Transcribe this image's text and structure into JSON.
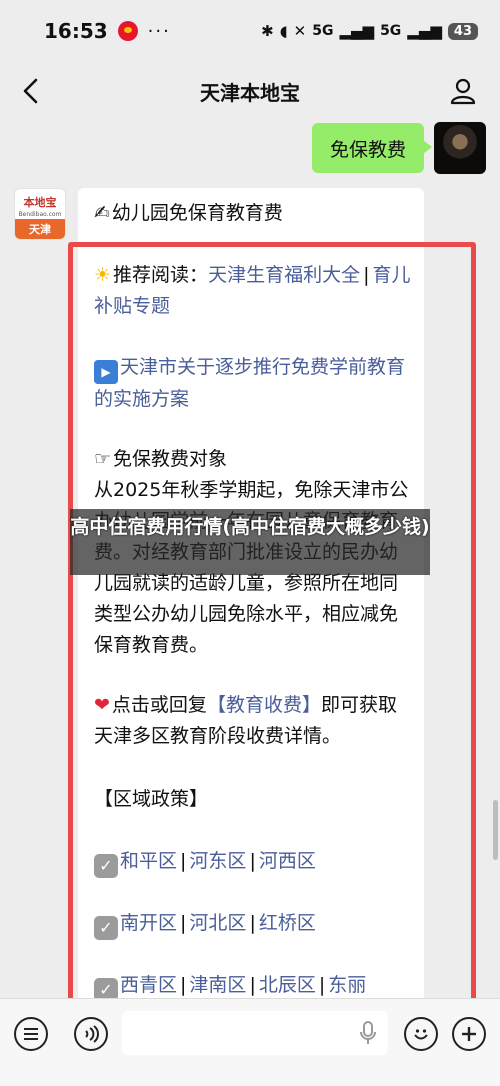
{
  "status_bar": {
    "time": "16:53",
    "dots": "···",
    "network_a": "5G",
    "network_b": "5G",
    "battery": "43"
  },
  "nav": {
    "title": "天津本地宝"
  },
  "chat": {
    "outgoing": "免保教费",
    "bot_logo": {
      "name": "本地宝",
      "domain": "Bendibao.com",
      "city": "天津"
    },
    "reply": {
      "heading": "幼儿园免保育教育费",
      "recommend_label": "推荐阅读：",
      "recommend_link1": "天津生育福利大全",
      "recommend_link2": "育儿补贴专题",
      "article_link": "天津市关于逐步推行免费学前教育的实施方案",
      "target_title": "免保教费对象",
      "target_text": "从2025年秋季学期起，免除天津市公办幼儿园学前一年在园儿童保育教育费。对经教育部门批准设立的民办幼儿园就读的适龄儿童，参照所在地同类型公办幼儿园免除水平，相应减免保育教育费。",
      "reply_prompt_pre": "点击或回复",
      "reply_keyword": "【教育收费】",
      "reply_prompt_post": "即可获取天津多区教育阶段收费详情。",
      "region_title": "【区域政策】",
      "districts": [
        [
          "和平区",
          "河东区",
          "河西区"
        ],
        [
          "南开区",
          "河北区",
          "红桥区"
        ],
        [
          "西青区",
          "津南区",
          "北辰区",
          "东丽"
        ]
      ]
    }
  },
  "caption": "高中住宿费用行情(高中住宿费大概多少钱)",
  "colors": {
    "outgoing_bubble": "#95ec69",
    "link": "#4a5e9a",
    "highlight_border": "#e94a4a",
    "background": "#ededed"
  },
  "icons": {
    "back": "back-arrow-icon",
    "profile": "person-icon",
    "voice": "voice-icon",
    "menu": "menu-icon",
    "emoji": "emoji-icon",
    "plus": "plus-icon",
    "mic": "microphone-icon"
  }
}
